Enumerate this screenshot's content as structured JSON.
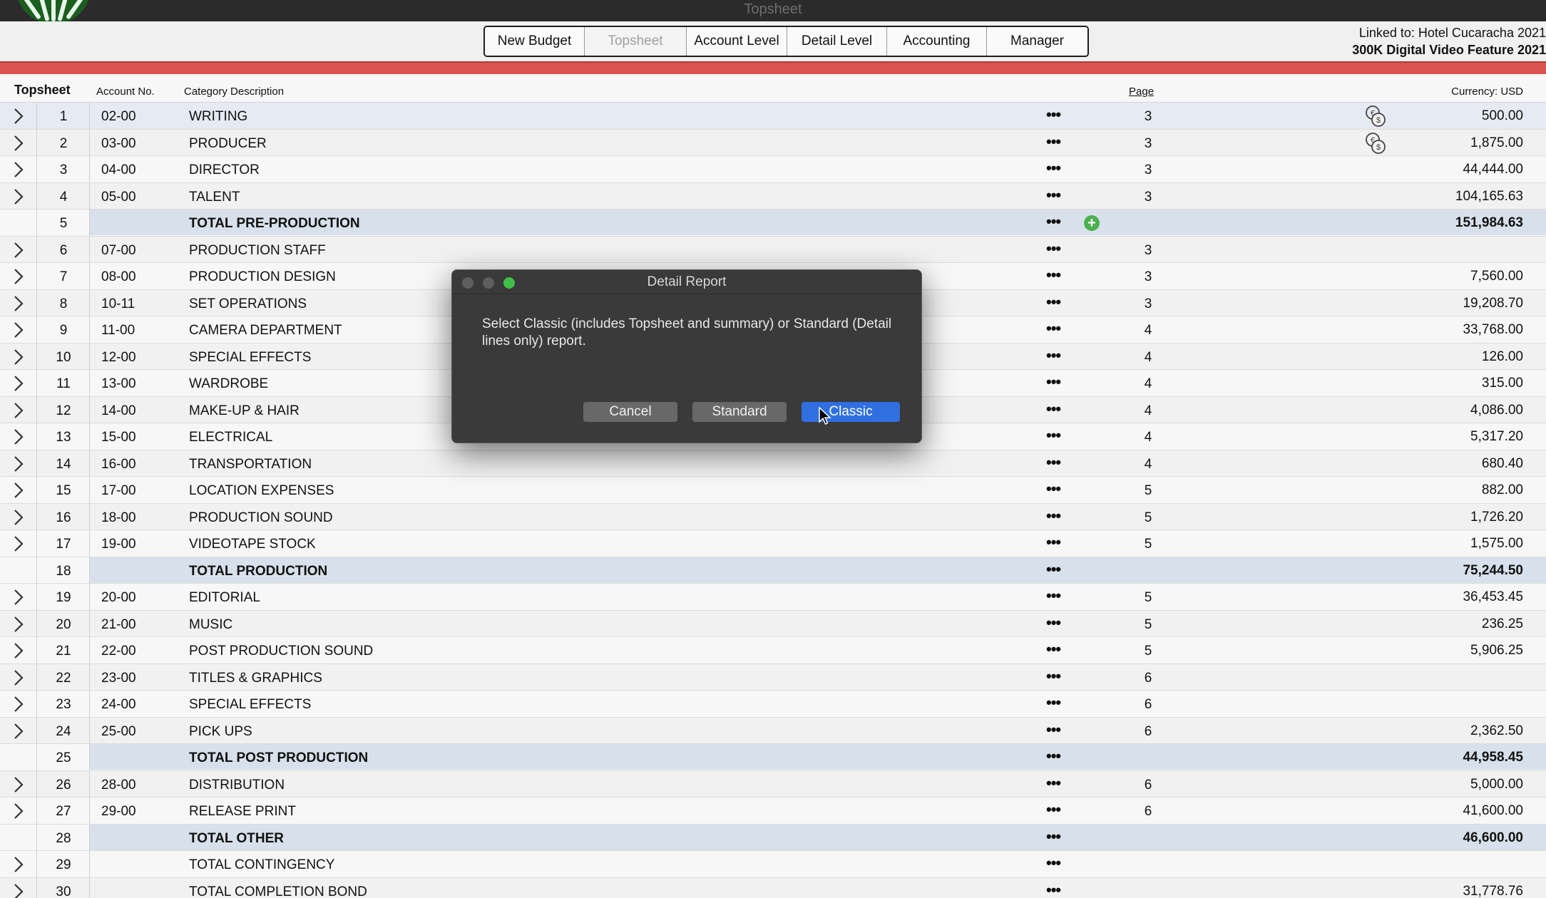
{
  "window": {
    "title": "Topsheet"
  },
  "toolbar": {
    "tabs": [
      {
        "label": "New Budget"
      },
      {
        "label": "Topsheet"
      },
      {
        "label": "Account Level"
      },
      {
        "label": "Detail Level"
      },
      {
        "label": "Accounting"
      },
      {
        "label": "Manager"
      }
    ],
    "linked_to": "Linked to: Hotel Cucaracha 2021",
    "budget_name": "300K Digital Video Feature 2021"
  },
  "columns": {
    "topsheet": "Topsheet",
    "account_no": "Account No.",
    "category": "Category Description",
    "page": "Page",
    "currency": "Currency: USD"
  },
  "rows": [
    {
      "num": "1",
      "acct": "02-00",
      "desc": "WRITING",
      "page": "3",
      "amount": "500.00",
      "expandable": true,
      "total": false,
      "icon": "currency-exchange-icon"
    },
    {
      "num": "2",
      "acct": "03-00",
      "desc": "PRODUCER",
      "page": "3",
      "amount": "1,875.00",
      "expandable": true,
      "total": false,
      "icon": "currency-exchange-icon"
    },
    {
      "num": "3",
      "acct": "04-00",
      "desc": "DIRECTOR",
      "page": "3",
      "amount": "44,444.00",
      "expandable": true,
      "total": false
    },
    {
      "num": "4",
      "acct": "05-00",
      "desc": "TALENT",
      "page": "3",
      "amount": "104,165.63",
      "expandable": true,
      "total": false
    },
    {
      "num": "5",
      "acct": "",
      "desc": "TOTAL PRE-PRODUCTION",
      "page": "",
      "amount": "151,984.63",
      "expandable": false,
      "total": true,
      "icon": "add-icon"
    },
    {
      "num": "6",
      "acct": "07-00",
      "desc": "PRODUCTION STAFF",
      "page": "3",
      "amount": "",
      "expandable": true,
      "total": false
    },
    {
      "num": "7",
      "acct": "08-00",
      "desc": "PRODUCTION DESIGN",
      "page": "3",
      "amount": "7,560.00",
      "expandable": true,
      "total": false
    },
    {
      "num": "8",
      "acct": "10-11",
      "desc": "SET OPERATIONS",
      "page": "3",
      "amount": "19,208.70",
      "expandable": true,
      "total": false
    },
    {
      "num": "9",
      "acct": "11-00",
      "desc": "CAMERA DEPARTMENT",
      "page": "4",
      "amount": "33,768.00",
      "expandable": true,
      "total": false
    },
    {
      "num": "10",
      "acct": "12-00",
      "desc": "SPECIAL EFFECTS",
      "page": "4",
      "amount": "126.00",
      "expandable": true,
      "total": false
    },
    {
      "num": "11",
      "acct": "13-00",
      "desc": "WARDROBE",
      "page": "4",
      "amount": "315.00",
      "expandable": true,
      "total": false
    },
    {
      "num": "12",
      "acct": "14-00",
      "desc": "MAKE-UP & HAIR",
      "page": "4",
      "amount": "4,086.00",
      "expandable": true,
      "total": false
    },
    {
      "num": "13",
      "acct": "15-00",
      "desc": "ELECTRICAL",
      "page": "4",
      "amount": "5,317.20",
      "expandable": true,
      "total": false
    },
    {
      "num": "14",
      "acct": "16-00",
      "desc": "TRANSPORTATION",
      "page": "4",
      "amount": "680.40",
      "expandable": true,
      "total": false
    },
    {
      "num": "15",
      "acct": "17-00",
      "desc": "LOCATION EXPENSES",
      "page": "5",
      "amount": "882.00",
      "expandable": true,
      "total": false
    },
    {
      "num": "16",
      "acct": "18-00",
      "desc": "PRODUCTION SOUND",
      "page": "5",
      "amount": "1,726.20",
      "expandable": true,
      "total": false
    },
    {
      "num": "17",
      "acct": "19-00",
      "desc": "VIDEOTAPE STOCK",
      "page": "5",
      "amount": "1,575.00",
      "expandable": true,
      "total": false
    },
    {
      "num": "18",
      "acct": "",
      "desc": "TOTAL PRODUCTION",
      "page": "",
      "amount": "75,244.50",
      "expandable": false,
      "total": true
    },
    {
      "num": "19",
      "acct": "20-00",
      "desc": "EDITORIAL",
      "page": "5",
      "amount": "36,453.45",
      "expandable": true,
      "total": false
    },
    {
      "num": "20",
      "acct": "21-00",
      "desc": "MUSIC",
      "page": "5",
      "amount": "236.25",
      "expandable": true,
      "total": false
    },
    {
      "num": "21",
      "acct": "22-00",
      "desc": "POST PRODUCTION SOUND",
      "page": "5",
      "amount": "5,906.25",
      "expandable": true,
      "total": false
    },
    {
      "num": "22",
      "acct": "23-00",
      "desc": "TITLES & GRAPHICS",
      "page": "6",
      "amount": "",
      "expandable": true,
      "total": false
    },
    {
      "num": "23",
      "acct": "24-00",
      "desc": "SPECIAL EFFECTS",
      "page": "6",
      "amount": "",
      "expandable": true,
      "total": false
    },
    {
      "num": "24",
      "acct": "25-00",
      "desc": "PICK UPS",
      "page": "6",
      "amount": "2,362.50",
      "expandable": true,
      "total": false
    },
    {
      "num": "25",
      "acct": "",
      "desc": "TOTAL POST PRODUCTION",
      "page": "",
      "amount": "44,958.45",
      "expandable": false,
      "total": true
    },
    {
      "num": "26",
      "acct": "28-00",
      "desc": "DISTRIBUTION",
      "page": "6",
      "amount": "5,000.00",
      "expandable": true,
      "total": false
    },
    {
      "num": "27",
      "acct": "29-00",
      "desc": "RELEASE PRINT",
      "page": "6",
      "amount": "41,600.00",
      "expandable": true,
      "total": false
    },
    {
      "num": "28",
      "acct": "",
      "desc": "TOTAL OTHER",
      "page": "",
      "amount": "46,600.00",
      "expandable": false,
      "total": true
    },
    {
      "num": "29",
      "acct": "",
      "desc": "TOTAL CONTINGENCY",
      "page": "",
      "amount": "",
      "expandable": true,
      "total": false
    },
    {
      "num": "30",
      "acct": "",
      "desc": "TOTAL COMPLETION BOND",
      "page": "",
      "amount": "31,778.76",
      "expandable": true,
      "total": false
    }
  ],
  "dialog": {
    "title": "Detail Report",
    "message": "Select Classic (includes Topsheet and summary) or Standard (Detail lines only) report.",
    "cancel": "Cancel",
    "standard": "Standard",
    "classic": "Classic"
  },
  "colors": {
    "accent": "#d9534f",
    "primary_button": "#2f6fe0",
    "total_row": "#d8e1eb",
    "selected_row": "#e6eaf2"
  },
  "more_glyph": "•••"
}
